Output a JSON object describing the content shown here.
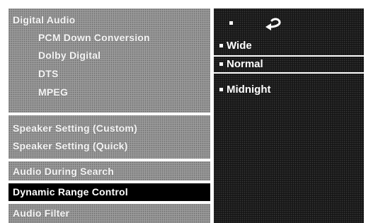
{
  "menu": {
    "items": [
      {
        "label": "Digital Audio"
      },
      {
        "label": "PCM Down Conversion"
      },
      {
        "label": "Dolby Digital"
      },
      {
        "label": "DTS"
      },
      {
        "label": "MPEG"
      },
      {
        "label": "Speaker Setting (Custom)"
      },
      {
        "label": "Speaker Setting (Quick)"
      },
      {
        "label": "Audio  During Search"
      },
      {
        "label": "Dynamic Range Control"
      },
      {
        "label": "Audio Filter"
      }
    ],
    "selected": "Dynamic Range Control"
  },
  "options": {
    "return_icon": "return-arrow-icon",
    "items": [
      {
        "label": "Wide"
      },
      {
        "label": "Normal"
      },
      {
        "label": "Midnight"
      }
    ],
    "selected": "Normal"
  }
}
